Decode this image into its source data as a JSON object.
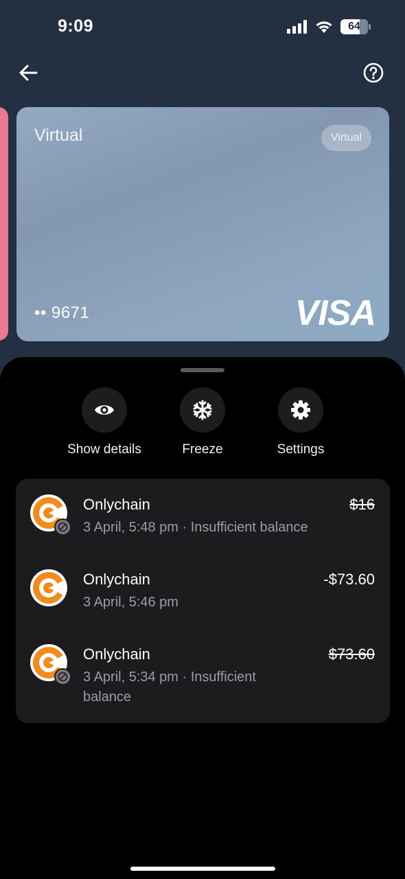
{
  "status_bar": {
    "time": "9:09",
    "battery": "64"
  },
  "card": {
    "title": "Virtual",
    "badge": "Virtual",
    "number": "•• 9671",
    "brand": "VISA"
  },
  "actions": [
    {
      "label": "Show details",
      "icon": "eye-icon"
    },
    {
      "label": "Freeze",
      "icon": "snowflake-icon"
    },
    {
      "label": "Settings",
      "icon": "gear-icon"
    }
  ],
  "transactions": [
    {
      "merchant": "Onlychain",
      "meta": "3 April, 5:48 pm · Insufficient balance",
      "amount": "$16",
      "declined": true
    },
    {
      "merchant": "Onlychain",
      "meta": "3 April, 5:46 pm",
      "amount": "-$73.60",
      "declined": false
    },
    {
      "merchant": "Onlychain",
      "meta": "3 April, 5:34 pm · Insufficient balance",
      "amount": "$73.60",
      "declined": true
    }
  ],
  "colors": {
    "background": "#223042",
    "card_gradient": "#8ea5bd",
    "sheet": "#000000",
    "panel": "#1c1c1e",
    "merchant_orange": "#f28a1c",
    "peek_card": "#e97a90"
  }
}
